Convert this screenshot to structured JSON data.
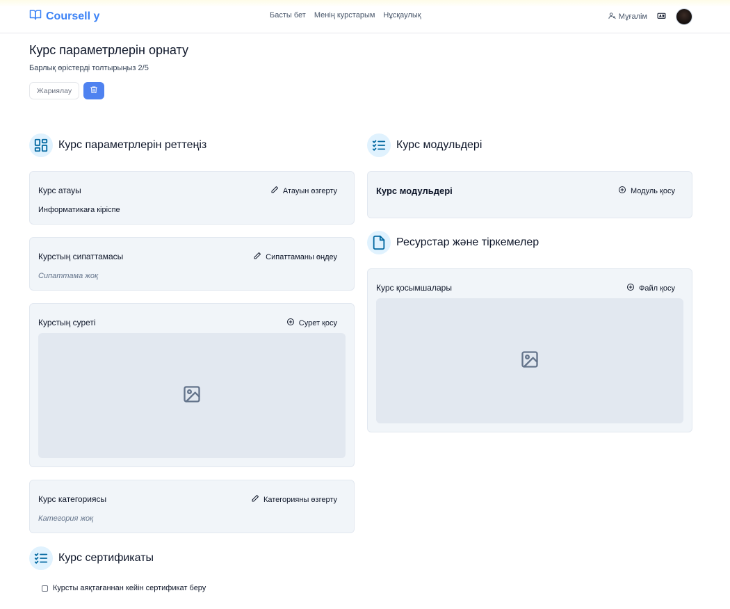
{
  "header": {
    "logo": "Coursell y",
    "nav": [
      "Басты бет",
      "Менің курстарым",
      "Нұсқаулық"
    ],
    "role": "Мұғалім"
  },
  "page": {
    "title": "Курс параметрлерін орнату",
    "subtitle": "Барлық өрістерді толтырыңыз 2/5",
    "publish_label": "Жариялау"
  },
  "left": {
    "section_title": "Курс параметрлерін реттеңіз",
    "name_card": {
      "label": "Курс атауы",
      "action": "Атауын өзгерту",
      "value": "Информатикаға кіріспе"
    },
    "desc_card": {
      "label": "Курстың сипаттамасы",
      "action": "Сипаттаманы өңдеу",
      "empty": "Сипаттама жоқ"
    },
    "image_card": {
      "label": "Курстың суреті",
      "action": "Сурет қосу"
    },
    "category_card": {
      "label": "Курс категориясы",
      "action": "Категорияны өзгерту",
      "empty": "Категория жоқ"
    },
    "cert_title": "Курс сертификаты",
    "cert_checkbox": "Курсты аяқтағаннан кейін сертификат беру"
  },
  "right": {
    "modules_title": "Курс модульдері",
    "modules_card": {
      "label": "Курс модульдері",
      "action": "Модуль қосу"
    },
    "resources_title": "Ресурстар және тіркемелер",
    "attachments_card": {
      "label": "Курс қосымшалары",
      "action": "Файл қосу"
    }
  },
  "colors": {
    "accent": "#3b82f6",
    "icon": "#0369a1",
    "card": "#f1f5f9",
    "placeholder": "#e2e8f0"
  }
}
